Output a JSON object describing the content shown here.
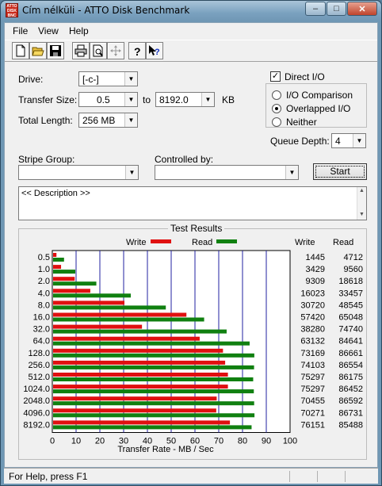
{
  "window": {
    "title": "Cím nélküli - ATTO Disk Benchmark",
    "icon_text": "ATTO DISK BENCH",
    "minimize_label": "–",
    "maximize_label": "□",
    "close_label": "✕"
  },
  "menu": {
    "items": [
      "File",
      "View",
      "Help"
    ]
  },
  "toolbar": {
    "buttons": [
      "new-icon",
      "open-icon",
      "save-icon",
      "print-icon",
      "print-preview-icon",
      "move-icon",
      "help-icon",
      "context-help-icon"
    ]
  },
  "form": {
    "drive_label": "Drive:",
    "drive_value": "[-c-]",
    "transfer_size_label": "Transfer Size:",
    "transfer_from": "0.5",
    "to_label": "to",
    "transfer_to": "8192.0",
    "kb_label": "KB",
    "total_length_label": "Total Length:",
    "total_length_value": "256 MB",
    "direct_io_label": "Direct I/O",
    "direct_io_checked": true,
    "radio_io_comparison": "I/O Comparison",
    "radio_overlapped_io": "Overlapped I/O",
    "radio_neither": "Neither",
    "selected_radio": "Overlapped I/O",
    "queue_depth_label": "Queue Depth:",
    "queue_depth_value": "4",
    "stripe_group_label": "Stripe Group:",
    "controlled_by_label": "Controlled by:",
    "start_label": "Start",
    "description_text": "<< Description >>"
  },
  "results": {
    "group_title": "Test Results",
    "legend_write": "Write",
    "legend_read": "Read",
    "col_write": "Write",
    "col_read": "Read"
  },
  "chart_data": {
    "type": "bar",
    "orientation": "horizontal",
    "categories": [
      "0.5",
      "1.0",
      "2.0",
      "4.0",
      "8.0",
      "16.0",
      "32.0",
      "64.0",
      "128.0",
      "256.0",
      "512.0",
      "1024.0",
      "2048.0",
      "4096.0",
      "8192.0"
    ],
    "series": [
      {
        "name": "Write",
        "color": "#e01010",
        "values": [
          1445,
          3429,
          9309,
          16023,
          30720,
          57420,
          38280,
          63132,
          73169,
          74103,
          75297,
          75297,
          70455,
          70271,
          76151
        ]
      },
      {
        "name": "Read",
        "color": "#108010",
        "values": [
          4712,
          9560,
          18618,
          33457,
          48545,
          65048,
          74740,
          84641,
          86661,
          86554,
          86175,
          86452,
          86592,
          86731,
          85488
        ]
      }
    ],
    "value_units": "KB/s",
    "xlabel": "Transfer Rate - MB / Sec",
    "xlim": [
      0,
      100
    ],
    "xticks": [
      "0",
      "10",
      "20",
      "30",
      "40",
      "50",
      "60",
      "70",
      "80",
      "90",
      "100"
    ],
    "grid": true,
    "legend_position": "top"
  },
  "status": {
    "text": "For Help, press F1"
  },
  "colors": {
    "write": "#e01010",
    "read": "#108010",
    "grid": "#2020a0"
  }
}
